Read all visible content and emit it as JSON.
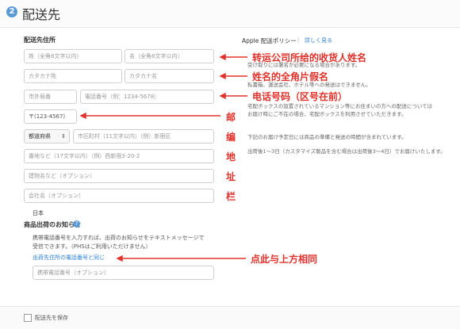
{
  "header": {
    "step_number": "2",
    "title": "配送先"
  },
  "form": {
    "section_label": "配送先住所",
    "last_name_placeholder": "姓（全角8文字以内）",
    "first_name_placeholder": "名（全角8文字以内）",
    "last_kana_placeholder": "カタカナ姓",
    "first_kana_placeholder": "カタカナ名",
    "area_code_placeholder": "市外局番",
    "phone_placeholder": "電話番号（例：1234-5678）",
    "postal_placeholder": "〒(123-4567)",
    "prefecture_label": "都道府県",
    "city_placeholder": "市区町村（11文字以内）（例）新宿区",
    "street_placeholder": "番地など（17文字以内）（例）西新宿3-20-2",
    "building_placeholder": "建物名など（オプション）",
    "company_placeholder": "会社名（オプション）",
    "country": "日本"
  },
  "notification": {
    "label": "商品出荷のお知らせ",
    "help_icon": "?",
    "desc_line1": "携帯電話番号を入力すれば、出荷のお知らせをテキストメッセージで",
    "desc_line2": "受信できます。（PHSはご利用いただけません）",
    "same_phone_link": "出荷先住所の電話番号と同じ",
    "mobile_placeholder": "携帯電話番号（オプション）"
  },
  "policy": {
    "title": "Apple 配送ポリシー",
    "separator": "|",
    "details_link": "詳しく見る",
    "bullet1": "受け取りには署名が必要になる場合があります。",
    "bullet2": "私書箱、運送会社、ホテル等への発送はできません。",
    "bullet3_line1": "宅配ボックスの設置されているマンション等にお住まいの方への配送については",
    "bullet3_line2": "お届け時にご不在の場合、宅配ボックスを利用させていただきます。",
    "bullet4": "下記のお届け予定日には商品の準備と発送の時間が含まれています。",
    "bullet5": "出荷後1〜3日（カスタマイズ製品を含む場合は出荷後3〜4日）でお届けいたします。"
  },
  "annotations": {
    "name": "转运公司所给的收货人姓名",
    "kana": "姓名的全角片假名",
    "phone": "电话号码（区号在前）",
    "postal_chars": [
      "邮",
      "编",
      "地",
      "址",
      "栏"
    ],
    "same_as_above": "点此与上方相同"
  },
  "footer": {
    "save_label": "配送先を保存"
  },
  "colors": {
    "accent": "#2a7fd4",
    "annotation": "#e0322b",
    "step_badge": "#5b9bd5"
  }
}
